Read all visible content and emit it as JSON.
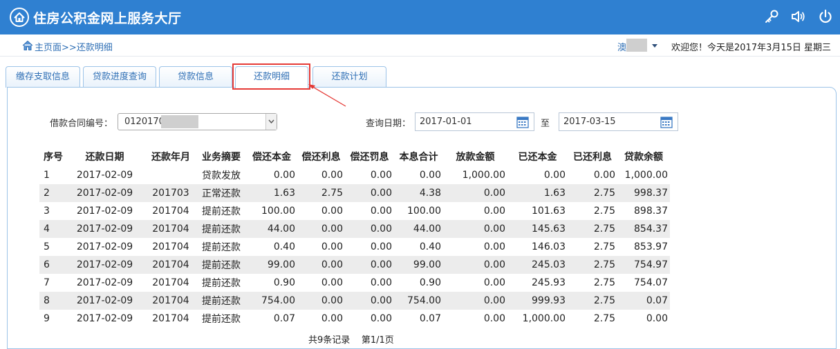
{
  "header": {
    "title": "住房公积金网上服务大厅",
    "icons": [
      "key-icon",
      "speaker-icon",
      "power-icon"
    ],
    "bg_color": "#2f80d1"
  },
  "subbar": {
    "breadcrumb": "主页面>>还款明细",
    "user_name": "澳",
    "welcome": "欢迎您！今天是2017年3月15日 星期三"
  },
  "tabs": [
    {
      "label": "缴存支取信息",
      "active": false
    },
    {
      "label": "贷款进度查询",
      "active": false
    },
    {
      "label": "贷款信息",
      "active": false
    },
    {
      "label": "还款明细",
      "active": true
    },
    {
      "label": "还款计划",
      "active": false
    }
  ],
  "form": {
    "contract_label": "借款合同编号：",
    "contract_value": "0120170",
    "query_date_label": "查询日期：",
    "date_from": "2017-01-01",
    "to_label": "至",
    "date_to": "2017-03-15"
  },
  "table": {
    "headers": [
      "序号",
      "还款日期",
      "还款年月",
      "业务摘要",
      "偿还本金",
      "偿还利息",
      "偿还罚息",
      "本息合计",
      "放款金额",
      "已还本金",
      "已还利息",
      "贷款余额"
    ],
    "rows": [
      [
        "1",
        "2017-02-09",
        "",
        "贷款发放",
        "0.00",
        "0.00",
        "0.00",
        "0.00",
        "1,000.00",
        "0.00",
        "0.00",
        "1,000.00"
      ],
      [
        "2",
        "2017-02-09",
        "201703",
        "正常还款",
        "1.63",
        "2.75",
        "0.00",
        "4.38",
        "0.00",
        "1.63",
        "2.75",
        "998.37"
      ],
      [
        "3",
        "2017-02-09",
        "201704",
        "提前还款",
        "100.00",
        "0.00",
        "0.00",
        "100.00",
        "0.00",
        "101.63",
        "2.75",
        "898.37"
      ],
      [
        "4",
        "2017-02-09",
        "201704",
        "提前还款",
        "44.00",
        "0.00",
        "0.00",
        "44.00",
        "0.00",
        "145.63",
        "2.75",
        "854.37"
      ],
      [
        "5",
        "2017-02-09",
        "201704",
        "提前还款",
        "0.40",
        "0.00",
        "0.00",
        "0.40",
        "0.00",
        "146.03",
        "2.75",
        "853.97"
      ],
      [
        "6",
        "2017-02-09",
        "201704",
        "提前还款",
        "99.00",
        "0.00",
        "0.00",
        "99.00",
        "0.00",
        "245.03",
        "2.75",
        "754.97"
      ],
      [
        "7",
        "2017-02-09",
        "201704",
        "提前还款",
        "0.90",
        "0.00",
        "0.00",
        "0.90",
        "0.00",
        "245.93",
        "2.75",
        "754.07"
      ],
      [
        "8",
        "2017-02-09",
        "201704",
        "提前还款",
        "754.00",
        "0.00",
        "0.00",
        "754.00",
        "0.00",
        "999.93",
        "2.75",
        "0.07"
      ],
      [
        "9",
        "2017-02-09",
        "201704",
        "提前还款",
        "0.07",
        "0.00",
        "0.00",
        "0.07",
        "0.00",
        "1,000.00",
        "2.75",
        "0.00"
      ]
    ]
  },
  "footer": {
    "record_count": "共9条记录",
    "page_info": "第1/1页"
  }
}
